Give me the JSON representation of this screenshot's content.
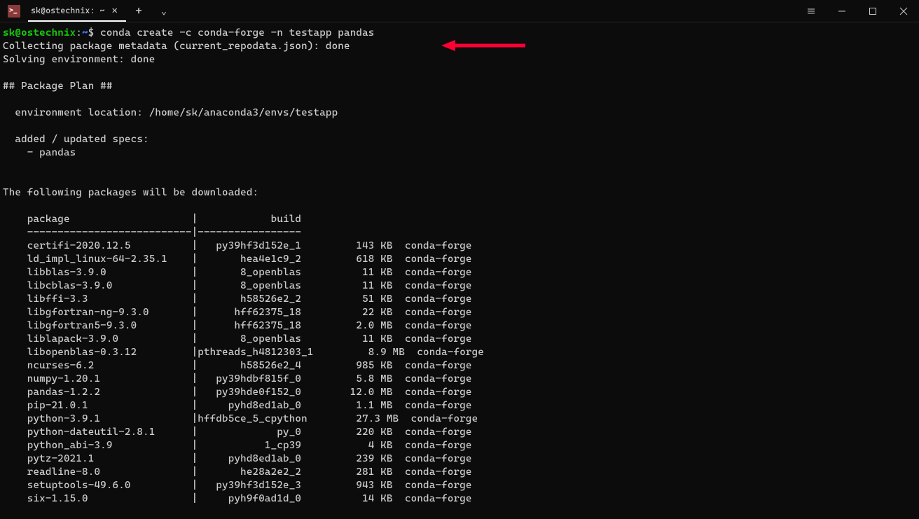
{
  "titlebar": {
    "tab_title": "sk@ostechnix: ~",
    "tab_icon_text": ">_"
  },
  "prompt": {
    "user_host": "sk@ostechnix",
    "colon": ":",
    "path": "~",
    "dollar": "$",
    "command": " conda create -c conda-forge -n testapp pandas"
  },
  "lines": {
    "l1": "Collecting package metadata (current_repodata.json): done",
    "l2": "Solving environment: done",
    "l3": "",
    "l4": "## Package Plan ##",
    "l5": "",
    "l6": "  environment location: /home/sk/anaconda3/envs/testapp",
    "l7": "",
    "l8": "  added / updated specs:",
    "l9": "    - pandas",
    "l10": "",
    "l11": "",
    "l12": "The following packages will be downloaded:",
    "l13": "",
    "l14": "    package                    |            build",
    "l15": "    ---------------------------|-----------------",
    "l16": "    certifi-2020.12.5          |   py39hf3d152e_1         143 KB  conda-forge",
    "l17": "    ld_impl_linux-64-2.35.1    |       hea4e1c9_2         618 KB  conda-forge",
    "l18": "    libblas-3.9.0              |       8_openblas          11 KB  conda-forge",
    "l19": "    libcblas-3.9.0             |       8_openblas          11 KB  conda-forge",
    "l20": "    libffi-3.3                 |       h58526e2_2          51 KB  conda-forge",
    "l21": "    libgfortran-ng-9.3.0       |      hff62375_18          22 KB  conda-forge",
    "l22": "    libgfortran5-9.3.0         |      hff62375_18         2.0 MB  conda-forge",
    "l23": "    liblapack-3.9.0            |       8_openblas          11 KB  conda-forge",
    "l24": "    libopenblas-0.3.12         |pthreads_h4812303_1         8.9 MB  conda-forge",
    "l25": "    ncurses-6.2                |       h58526e2_4         985 KB  conda-forge",
    "l26": "    numpy-1.20.1               |   py39hdbf815f_0         5.8 MB  conda-forge",
    "l27": "    pandas-1.2.2               |   py39hde0f152_0        12.0 MB  conda-forge",
    "l28": "    pip-21.0.1                 |     pyhd8ed1ab_0         1.1 MB  conda-forge",
    "l29": "    python-3.9.1               |hffdb5ce_5_cpython        27.3 MB  conda-forge",
    "l30": "    python-dateutil-2.8.1      |             py_0         220 KB  conda-forge",
    "l31": "    python_abi-3.9             |           1_cp39           4 KB  conda-forge",
    "l32": "    pytz-2021.1                |     pyhd8ed1ab_0         239 KB  conda-forge",
    "l33": "    readline-8.0               |       he28a2e2_2         281 KB  conda-forge",
    "l34": "    setuptools-49.6.0          |   py39hf3d152e_3         943 KB  conda-forge",
    "l35": "    six-1.15.0                 |     pyh9f0ad1d_0          14 KB  conda-forge"
  }
}
